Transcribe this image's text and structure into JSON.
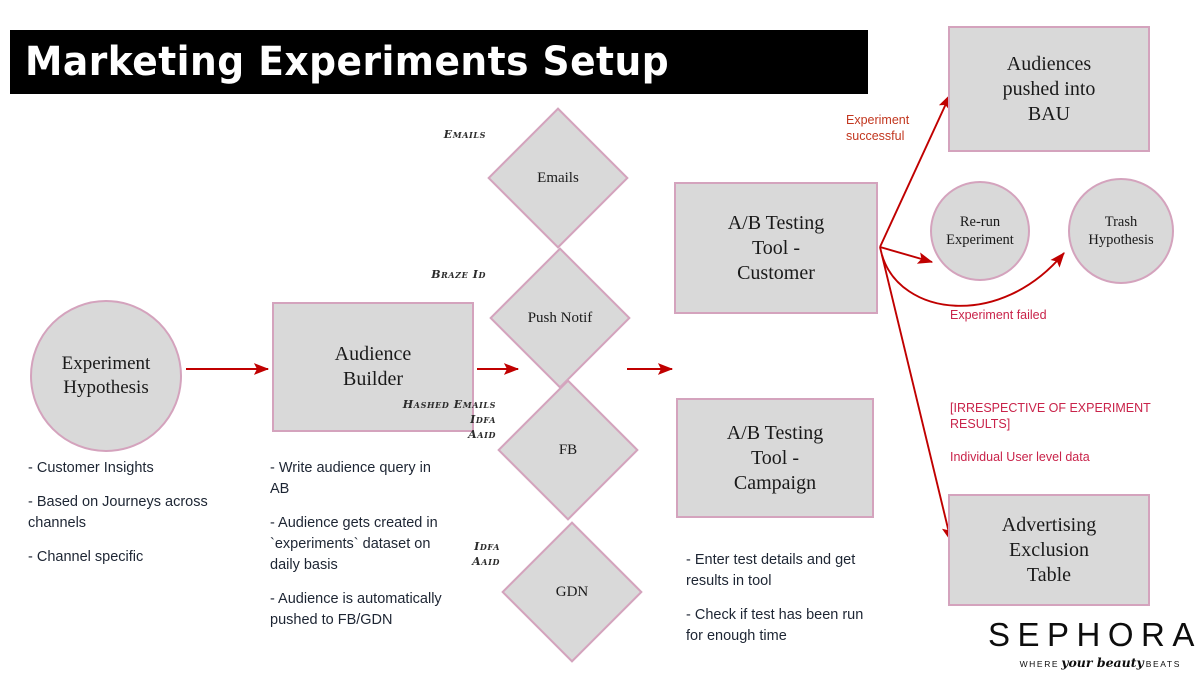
{
  "title": "Marketing Experiments Setup",
  "colors": {
    "node_fill": "#d9d9d9",
    "node_border": "#d4a3bd",
    "arrow": "#c00000",
    "annotation_red": "#c9234a",
    "annotation_orange": "#c2371f",
    "title_bar": "#000000",
    "title_text": "#ffffff"
  },
  "nodes": {
    "hypothesis": "Experiment\nHypothesis",
    "audience_builder": "Audience\nBuilder",
    "ab_customer": "A/B Testing\nTool -\nCustomer",
    "ab_campaign": "A/B Testing\nTool -\nCampaign",
    "bau": "Audiences\npushed into\nBAU",
    "rerun": "Re-run\nExperiment",
    "trash": "Trash\nHypothesis",
    "exclusion": "Advertising\nExclusion\nTable"
  },
  "channels": [
    {
      "label": "Emails",
      "id_tag": "Emails"
    },
    {
      "label": "Push Notif",
      "id_tag": "Braze Id"
    },
    {
      "label": "FB",
      "id_tag": "Hashed Emails\nIdfa\nAaid"
    },
    {
      "label": "GDN",
      "id_tag": "Idfa\nAaid"
    }
  ],
  "bullets": {
    "hypothesis": [
      "- Customer Insights",
      "- Based on Journeys across channels",
      "- Channel specific"
    ],
    "audience_builder": [
      "- Write audience query in AB",
      "-  Audience gets created in `experiments` dataset on daily basis",
      "- Audience is automatically pushed to FB/GDN"
    ],
    "ab_campaign": [
      "- Enter test details and get results in tool",
      "- Check if test has been run for enough time"
    ]
  },
  "annotations": {
    "experiment_successful": "Experiment\nsuccessful",
    "experiment_failed": "Experiment failed",
    "irrespective": "[IRRESPECTIVE OF EXPERIMENT RESULTS]",
    "individual_user": "Individual User level data"
  },
  "logo": {
    "wordmark": "SEPHORA",
    "tagline_pre": "WHERE",
    "tagline_script": "your beauty",
    "tagline_post": "BEATS"
  }
}
